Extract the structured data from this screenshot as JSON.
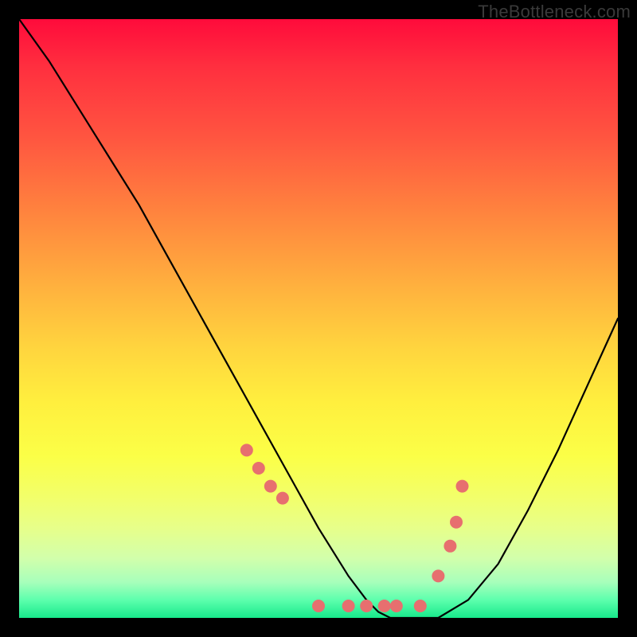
{
  "watermark": "TheBottleneck.com",
  "chart_data": {
    "type": "line",
    "title": "",
    "xlabel": "",
    "ylabel": "",
    "xlim": [
      0,
      100
    ],
    "ylim": [
      0,
      100
    ],
    "grid": false,
    "legend": false,
    "series": [
      {
        "name": "bottleneck-curve",
        "x": [
          0,
          5,
          10,
          15,
          20,
          25,
          30,
          35,
          40,
          45,
          50,
          55,
          58,
          60,
          62,
          65,
          70,
          75,
          80,
          85,
          90,
          95,
          100
        ],
        "values": [
          100,
          93,
          85,
          77,
          69,
          60,
          51,
          42,
          33,
          24,
          15,
          7,
          3,
          1,
          0,
          0,
          0,
          3,
          9,
          18,
          28,
          39,
          50
        ]
      }
    ],
    "markers": {
      "name": "highlight-dots",
      "color": "#e76f6f",
      "x": [
        38,
        40,
        42,
        44,
        50,
        55,
        58,
        61,
        63,
        67,
        70,
        72,
        73,
        74
      ],
      "values": [
        28,
        25,
        22,
        20,
        2,
        2,
        2,
        2,
        2,
        2,
        7,
        12,
        16,
        22
      ]
    },
    "gradient_colors": {
      "top": "#ff0b3b",
      "mid": "#ffe43e",
      "bottom": "#17e98b"
    }
  }
}
